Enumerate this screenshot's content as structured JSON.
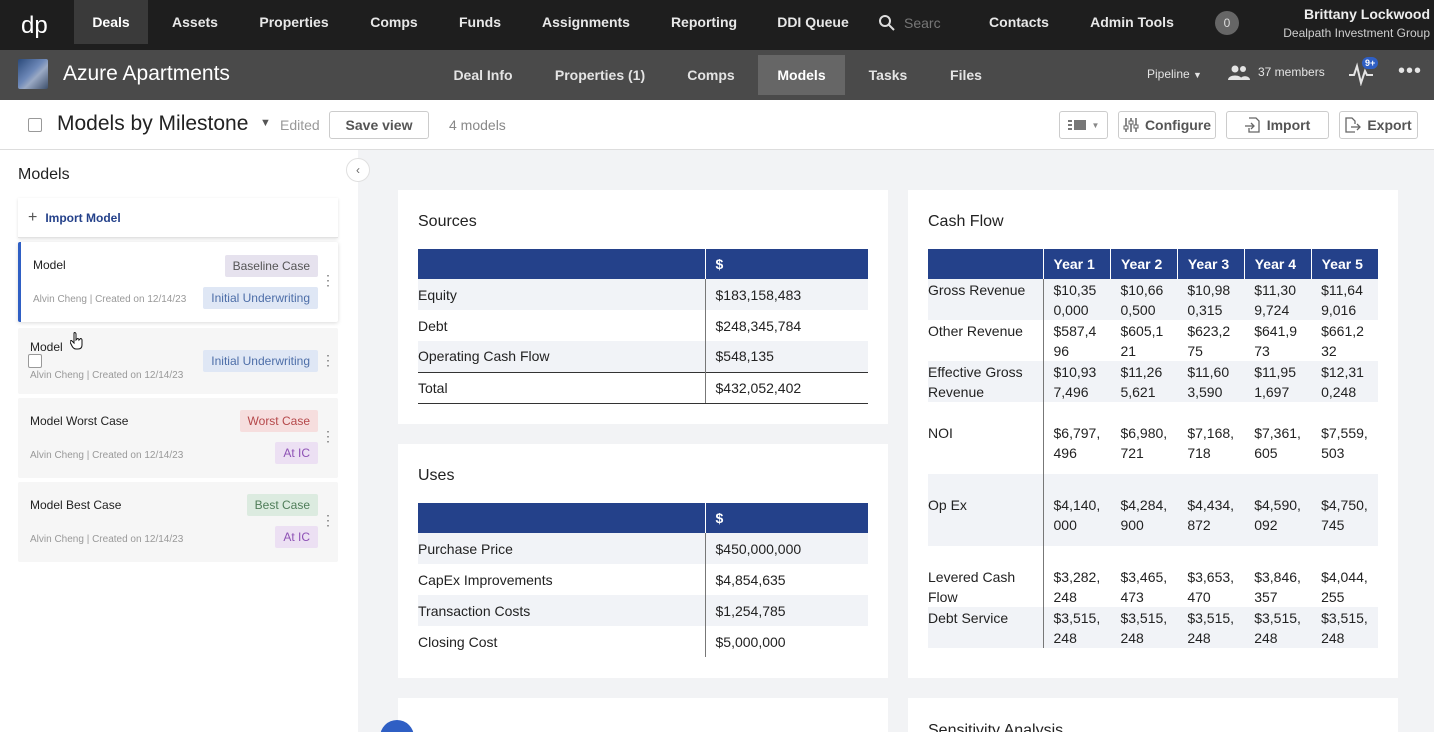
{
  "topnav": {
    "logo": "dp",
    "items": [
      "Deals",
      "Assets",
      "Properties",
      "Comps",
      "Funds",
      "Assignments",
      "Reporting",
      "DDI Queue"
    ],
    "search_placeholder": "Searc",
    "items_right": [
      "Contacts",
      "Admin Tools"
    ],
    "avatar_count": "0",
    "user_name": "Brittany Lockwood",
    "user_org": "Dealpath Investment Group"
  },
  "deal": {
    "title": "Azure Apartments",
    "tabs": [
      "Deal Info",
      "Properties (1)",
      "Comps",
      "Models",
      "Tasks",
      "Files"
    ],
    "pipeline": "Pipeline",
    "members": "37 members",
    "notif_badge": "9+"
  },
  "viewbar": {
    "title": "Models by Milestone",
    "edited": "Edited",
    "save_view": "Save view",
    "count": "4 models",
    "configure": "Configure",
    "import": "Import",
    "export": "Export"
  },
  "models_panel": {
    "title": "Models",
    "import_model": "Import Model",
    "cards": [
      {
        "name": "Model",
        "meta": "Alvin Cheng | Created on 12/14/23",
        "tags": [
          "Baseline Case",
          "Initial Underwriting"
        ]
      },
      {
        "name": "Model",
        "meta": "Alvin Cheng | Created on 12/14/23",
        "tags": [
          "Initial Underwriting"
        ]
      },
      {
        "name": "Model Worst Case",
        "meta": "Alvin Cheng | Created on 12/14/23",
        "tags": [
          "Worst Case",
          "At IC"
        ]
      },
      {
        "name": "Model Best Case",
        "meta": "Alvin Cheng | Created on 12/14/23",
        "tags": [
          "Best Case",
          "At IC"
        ]
      }
    ]
  },
  "sources": {
    "title": "Sources",
    "header": [
      "",
      "$"
    ],
    "rows": [
      [
        "Equity",
        "$183,158,483"
      ],
      [
        "Debt",
        "$248,345,784"
      ],
      [
        "Operating Cash Flow",
        "$548,135"
      ],
      [
        "Total",
        "$432,052,402"
      ]
    ]
  },
  "uses": {
    "title": "Uses",
    "header": [
      "",
      "$"
    ],
    "rows": [
      [
        "Purchase Price",
        "$450,000,000"
      ],
      [
        "CapEx Improvements",
        "$4,854,635"
      ],
      [
        "Transaction Costs",
        "$1,254,785"
      ],
      [
        "Closing Cost",
        "$5,000,000"
      ]
    ]
  },
  "cashflow": {
    "title": "Cash Flow",
    "header": [
      "",
      "Year 1",
      "Year 2",
      "Year 3",
      "Year 4",
      "Year 5"
    ],
    "rows": [
      [
        "Gross Revenue",
        "$10,35\n0,000",
        "$10,66\n0,500",
        "$10,98\n0,315",
        "$11,30\n9,724",
        "$11,64\n9,016"
      ],
      [
        "Other Revenue",
        "$587,4\n96",
        "$605,1\n21",
        "$623,2\n75",
        "$641,9\n73",
        "$661,2\n32"
      ],
      [
        "Effective Gross Revenue",
        "$10,93\n7,496",
        "$11,26\n5,621",
        "$11,60\n3,590",
        "$11,95\n1,697",
        "$12,31\n0,248"
      ],
      [
        "NOI",
        "$6,797,\n496",
        "$6,980,\n721",
        "$7,168,\n718",
        "$7,361,\n605",
        "$7,559,\n503"
      ],
      [
        "Op Ex",
        "$4,140,\n000",
        "$4,284,\n900",
        "$4,434,\n872",
        "$4,590,\n092",
        "$4,750,\n745"
      ],
      [
        "Levered Cash Flow",
        "$3,282,\n248",
        "$3,465,\n473",
        "$3,653,\n470",
        "$3,846,\n357",
        "$4,044,\n255"
      ],
      [
        "Debt Service",
        "$3,515,\n248",
        "$3,515,\n248",
        "$3,515,\n248",
        "$3,515,\n248",
        "$3,515,\n248"
      ]
    ]
  },
  "sensitivity": {
    "title": "Sensitivity Analysis"
  }
}
